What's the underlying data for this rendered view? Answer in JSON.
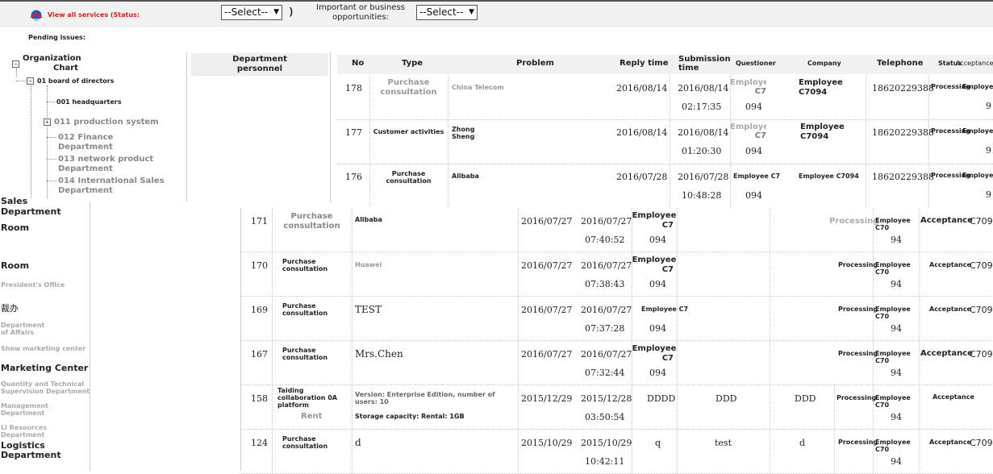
{
  "header": {
    "view_all": "View all services (Status:",
    "select1": "--Select--",
    "paren": ")",
    "important_line1": "Important or business",
    "important_line2": "opportunities:",
    "select2": "--Select--",
    "pending": "Pending issues:"
  },
  "tree": {
    "root_line1": "Organization",
    "root_line2": "Chart",
    "board": "01 board of directors",
    "hq": "001 headquarters",
    "production": "011 production system",
    "finance_1": "012 Finance",
    "finance_2": "Department",
    "network_1": "013 network product",
    "network_2": "Department",
    "intl_1": "014 International Sales",
    "intl_2": "Department"
  },
  "dept_personnel": {
    "line1": "Department",
    "line2": "personnel"
  },
  "upper_table": {
    "headers": {
      "no": "No",
      "type": "Type",
      "problem": "Problem",
      "reply": "Reply time",
      "submission_1": "Submission",
      "submission_2": "time",
      "questioner": "Questioner",
      "company": "Company",
      "telephone": "Telephone",
      "status": "Status",
      "acceptance": "Acceptance"
    },
    "rows": [
      {
        "no": "178",
        "type_1": "Purchase",
        "type_2": "consultation",
        "problem": "China Telecom",
        "reply": "2016/08/14",
        "sub_date": "2016/08/14",
        "sub_time": "02:17:35",
        "q_1": "Employee",
        "q_2": "C7",
        "q_3": "094",
        "company_1": "Employee",
        "company_2": "C7094",
        "tel": "18620229388",
        "status": "Processing",
        "accept": "Employee",
        "accept_2": "9"
      },
      {
        "no": "177",
        "type_1": "Customer activities",
        "type_2": "",
        "problem_1": "Zhong",
        "problem_2": "Sheng",
        "reply": "2016/08/14",
        "sub_date": "2016/08/14",
        "sub_time": "01:20:30",
        "q_1": "Employee",
        "q_2": "C7",
        "q_3": "094",
        "company_1": "Employee",
        "company_2": "C7094",
        "tel": "18620229388",
        "status": "Processing",
        "accept": "Employee",
        "accept_2": "9"
      },
      {
        "no": "176",
        "type_1": "Purchase",
        "type_2": "consultation",
        "problem": "Alibaba",
        "reply": "2016/07/28",
        "sub_date": "2016/07/28",
        "sub_time": "10:48:28",
        "q_1": "Employee C7",
        "q_3": "094",
        "company_1": "Employee C7094",
        "tel": "18620229388",
        "status": "Processing",
        "accept": "Employee",
        "accept_2": "9"
      }
    ]
  },
  "left_list": {
    "sales_1": "Sales",
    "sales_2": "Department",
    "room1": "Room",
    "room2": "Room",
    "president": "President's Office",
    "cjk": "裁办",
    "affairs_1": "Department",
    "affairs_2": "of Affairs",
    "show_mkt": "Show marketing center",
    "mkt_center": "Marketing Center",
    "quality_1": "Quantity and Technical",
    "quality_2": "Supervision Department",
    "mgmt_1": "Management",
    "mgmt_2": "Department",
    "li_1": "Li Resources",
    "li_2": "Department",
    "logistics_1": "Logistics",
    "logistics_2": "Department"
  },
  "lower_table": {
    "rows": [
      {
        "no": "171",
        "type_1": "Purchase",
        "type_2": "consultation",
        "problem": "Alibaba",
        "reply": "2016/07/27",
        "sub_date": "2016/07/27",
        "sub_time": "07:40:52",
        "q_1": "Employee",
        "q_2": "C7",
        "q_3": "094",
        "status": "Processing",
        "accept": "Employee C70",
        "accept_2": "94",
        "acc_status": "Acceptance",
        "code": "C709"
      },
      {
        "no": "170",
        "type_1": "Purchase",
        "type_2": "consultation",
        "problem": "Huawei",
        "reply": "2016/07/27",
        "sub_date": "2016/07/27",
        "sub_time": "07:38:43",
        "q_1": "Employee",
        "q_2": "C7",
        "q_3": "094",
        "status": "Processing",
        "accept": "Employee C70",
        "accept_2": "94",
        "acc_status": "Acceptance",
        "code": "C709"
      },
      {
        "no": "169",
        "type_1": "Purchase",
        "type_2": "consultation",
        "problem": "TEST",
        "reply": "2016/07/27",
        "sub_date": "2016/07/27",
        "sub_time": "07:37:28",
        "q_1": "Employee C7",
        "q_3": "094",
        "status": "Processing",
        "accept": "Employee C70",
        "accept_2": "94",
        "acc_status": "Acceptance",
        "code": "C709"
      },
      {
        "no": "167",
        "type_1": "Purchase",
        "type_2": "consultation",
        "problem": "Mrs.Chen",
        "reply": "2016/07/27",
        "sub_date": "2016/07/27",
        "sub_time": "07:32:44",
        "q_1": "Employee",
        "q_2": "C7",
        "q_3": "094",
        "status": "Processing",
        "accept": "Employee C70",
        "accept_2": "94",
        "acc_status": "Acceptance",
        "code": "C709"
      },
      {
        "no": "158",
        "type_1": "Taiding collaboration 0A platform",
        "type_2": "Rent",
        "problem_1": "Version: Enterprise Edition, number of users: 10",
        "problem_2": "Storage capacity: Rental: 1GB",
        "reply": "2015/12/29",
        "sub_date": "2015/12/28",
        "sub_time": "03:50:54",
        "q_1": "DDDD",
        "c1": "DDD",
        "c2": "DDD",
        "status": "Processing",
        "accept": "Employee C70",
        "accept_2": "94",
        "acc_status": "Acceptance"
      },
      {
        "no": "124",
        "type_1": "Purchase",
        "type_2": "consultation",
        "problem": "d",
        "reply": "2015/10/29",
        "sub_date": "2015/10/29",
        "sub_time": "10:42:11",
        "q_1": "q",
        "c1": "test",
        "c2": "d",
        "status": "Processing",
        "accept": "Employee C70",
        "accept_2": "94",
        "acc_status": "Acceptance",
        "code": "C709"
      }
    ]
  }
}
